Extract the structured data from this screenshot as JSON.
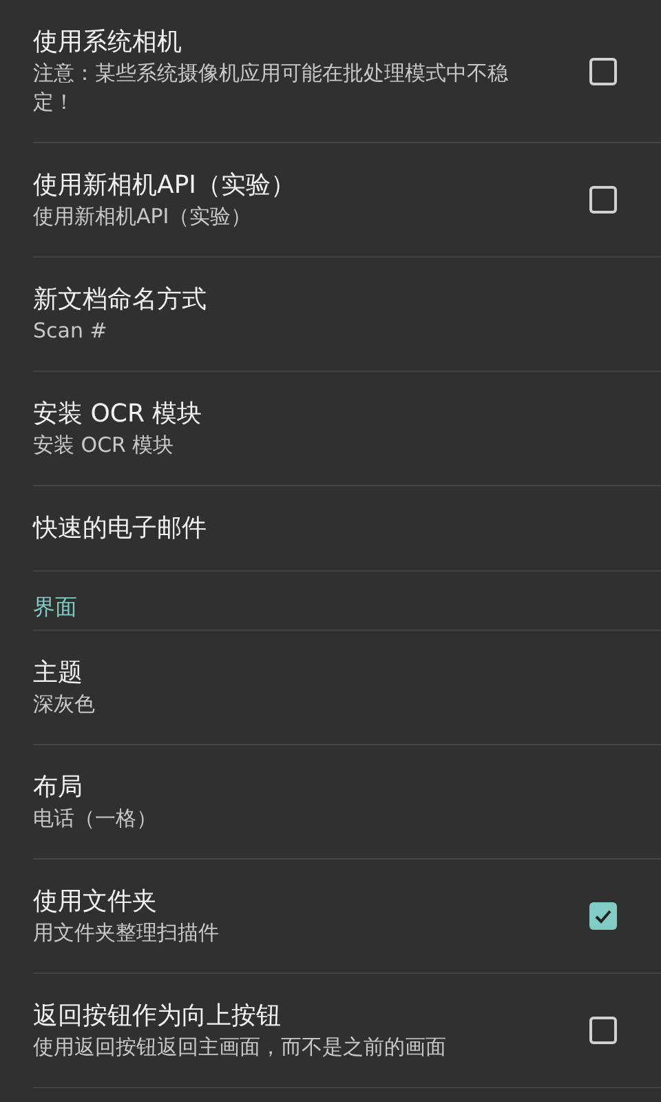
{
  "items": [
    {
      "kind": "checkbox",
      "title": "使用系统相机",
      "summary": "注意：某些系统摄像机应用可能在批处理模式中不稳定！",
      "checked": false
    },
    {
      "kind": "checkbox",
      "title": "使用新相机API（实验）",
      "summary": "使用新相机API（实验）",
      "checked": false
    },
    {
      "kind": "text",
      "title": "新文档命名方式",
      "summary": "Scan #"
    },
    {
      "kind": "text",
      "title": "安装 OCR 模块",
      "summary": "安装 OCR 模块"
    },
    {
      "kind": "text",
      "title": "快速的电子邮件"
    },
    {
      "kind": "header",
      "title": "界面"
    },
    {
      "kind": "text",
      "title": "主题",
      "summary": "深灰色"
    },
    {
      "kind": "text",
      "title": "布局",
      "summary": "电话（一格）"
    },
    {
      "kind": "checkbox",
      "title": "使用文件夹",
      "summary": "用文件夹整理扫描件",
      "checked": true
    },
    {
      "kind": "checkbox",
      "title": "返回按钮作为向上按钮",
      "summary": "使用返回按钮返回主画面，而不是之前的画面",
      "checked": false
    }
  ]
}
